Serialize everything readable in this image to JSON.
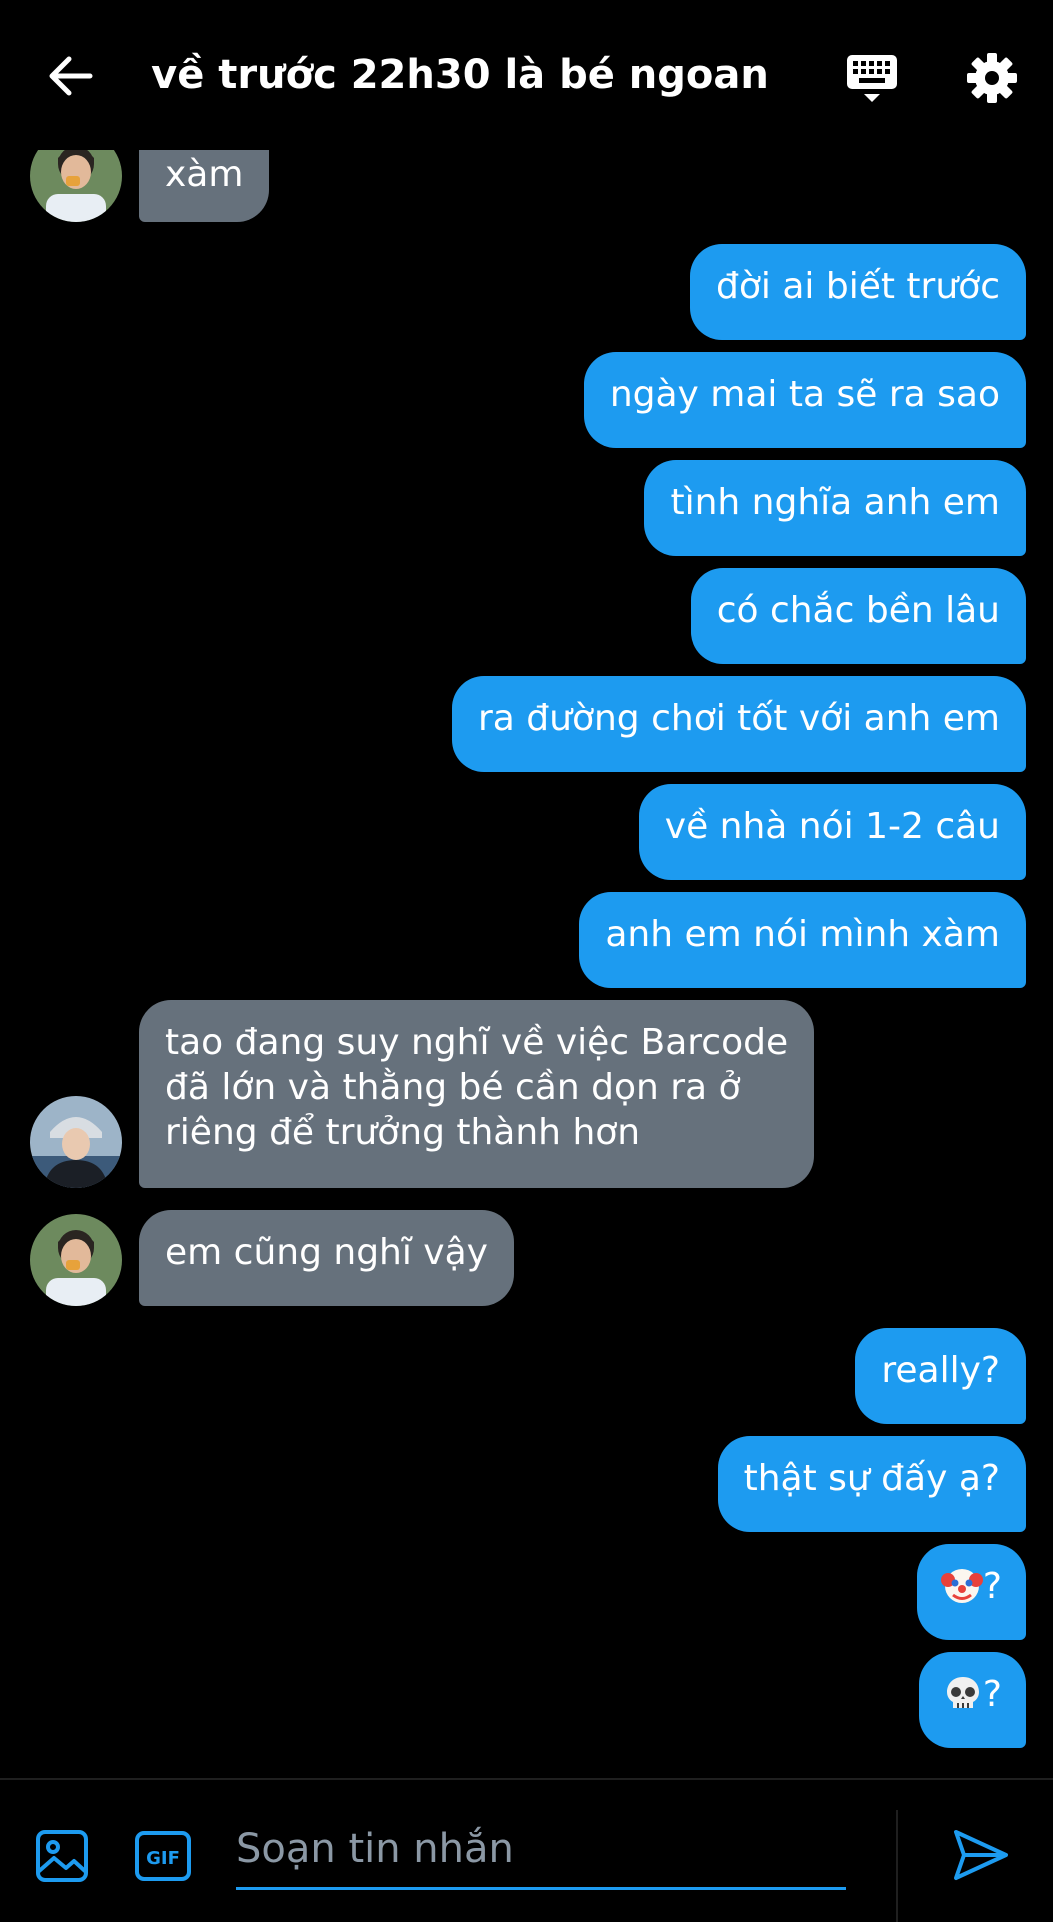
{
  "header": {
    "title": "về trước 22h30 là bé ngoan",
    "back_icon": "arrow-left-icon",
    "keyboard_icon": "keyboard-icon",
    "settings_icon": "gear-icon"
  },
  "messages": [
    {
      "direction": "in",
      "text": "xàm",
      "avatar": "avatar-b"
    },
    {
      "direction": "out",
      "text": "đời ai biết trước"
    },
    {
      "direction": "out",
      "text": "ngày mai ta sẽ ra sao"
    },
    {
      "direction": "out",
      "text": "tình nghĩa anh em"
    },
    {
      "direction": "out",
      "text": "có chắc bền lâu"
    },
    {
      "direction": "out",
      "text": "ra đường chơi tốt với anh em"
    },
    {
      "direction": "out",
      "text": "về nhà nói 1-2 câu"
    },
    {
      "direction": "out",
      "text": "anh em nói mình xàm"
    },
    {
      "direction": "in",
      "lines": [
        "tao đang suy nghĩ về việc Barcode",
        "đã lớn và thằng bé cần dọn ra ở",
        "riêng để trưởng thành hơn"
      ],
      "avatar": "avatar-a"
    },
    {
      "direction": "in",
      "text": "em cũng nghĩ vậy",
      "avatar": "avatar-b"
    },
    {
      "direction": "out",
      "text": "really?"
    },
    {
      "direction": "out",
      "text": "thật sự đấy ạ?"
    },
    {
      "direction": "out",
      "emoji": "clown-face-emoji",
      "text": "?"
    },
    {
      "direction": "out",
      "emoji": "skull-emoji",
      "text": "?"
    }
  ],
  "composer": {
    "placeholder": "Soạn tin nhắn",
    "gif_label": "GIF",
    "media_icon": "image-icon",
    "send_icon": "send-icon"
  },
  "colors": {
    "background": "#000000",
    "outgoing_bubble": "#1d9bf0",
    "incoming_bubble": "#66717c",
    "accent": "#1d9bf0"
  }
}
